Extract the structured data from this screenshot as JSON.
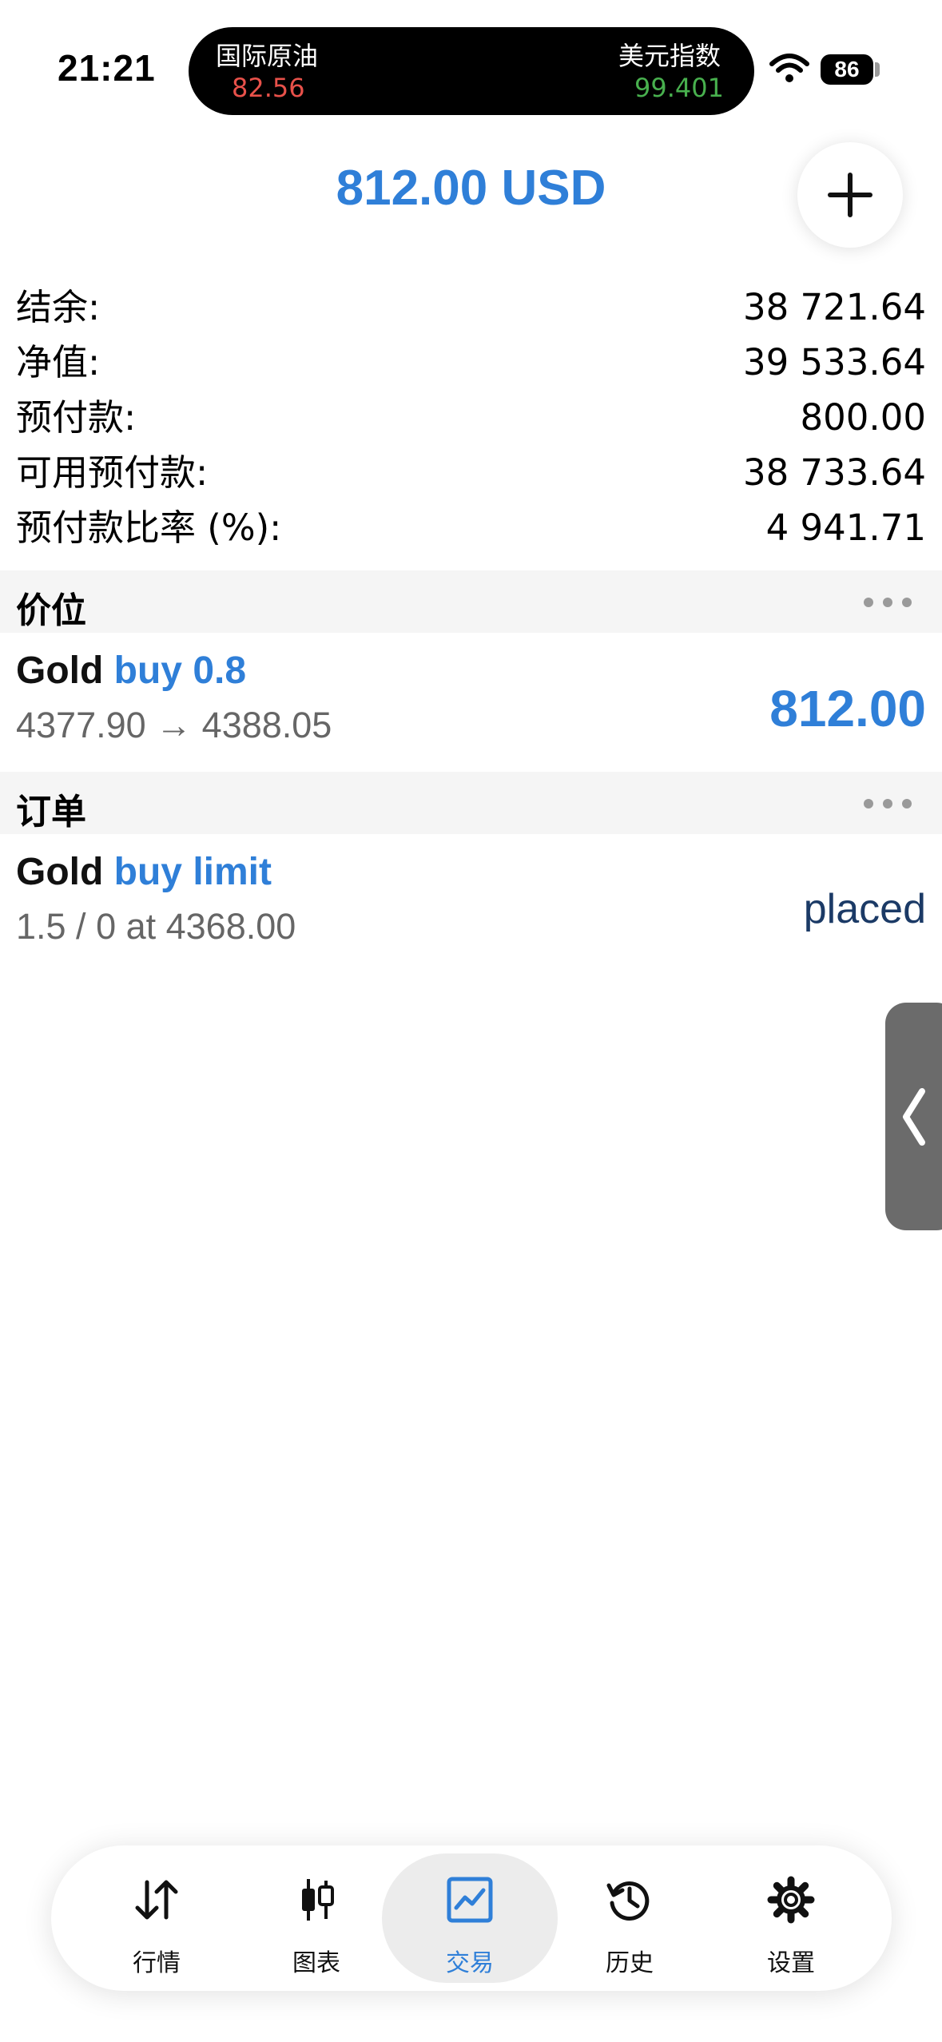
{
  "status_bar": {
    "time": "21:21",
    "ticker_left": {
      "name": "国际原油",
      "value": "82.56"
    },
    "ticker_right": {
      "name": "美元指数",
      "value": "99.401"
    },
    "battery": "86"
  },
  "header": {
    "title": "812.00 USD",
    "add_icon": "plus-icon"
  },
  "summary": [
    {
      "label": "结余:",
      "value": "38 721.64"
    },
    {
      "label": "净值:",
      "value": "39 533.64"
    },
    {
      "label": "预付款:",
      "value": "800.00"
    },
    {
      "label": "可用预付款:",
      "value": "38 733.64"
    },
    {
      "label": "预付款比率 (%):",
      "value": "4 941.71"
    }
  ],
  "positions": {
    "title": "价位",
    "items": [
      {
        "symbol": "Gold",
        "type": "buy 0.8",
        "prices": "4377.90 → 4388.05",
        "profit": "812.00"
      }
    ]
  },
  "orders": {
    "title": "订单",
    "items": [
      {
        "symbol": "Gold",
        "type": "buy limit",
        "details": "1.5 / 0 at 4368.00",
        "status": "placed"
      }
    ]
  },
  "tabs": [
    {
      "label": "行情",
      "icon": "arrows-up-down-icon",
      "active": false
    },
    {
      "label": "图表",
      "icon": "candlestick-icon",
      "active": false
    },
    {
      "label": "交易",
      "icon": "chart-line-icon",
      "active": true
    },
    {
      "label": "历史",
      "icon": "history-icon",
      "active": false
    },
    {
      "label": "设置",
      "icon": "gear-icon",
      "active": false
    }
  ],
  "colors": {
    "accent": "#2f7fd8",
    "ticker_down": "#e8514a",
    "ticker_up": "#48b04e",
    "status_placed": "#1b3a66"
  }
}
